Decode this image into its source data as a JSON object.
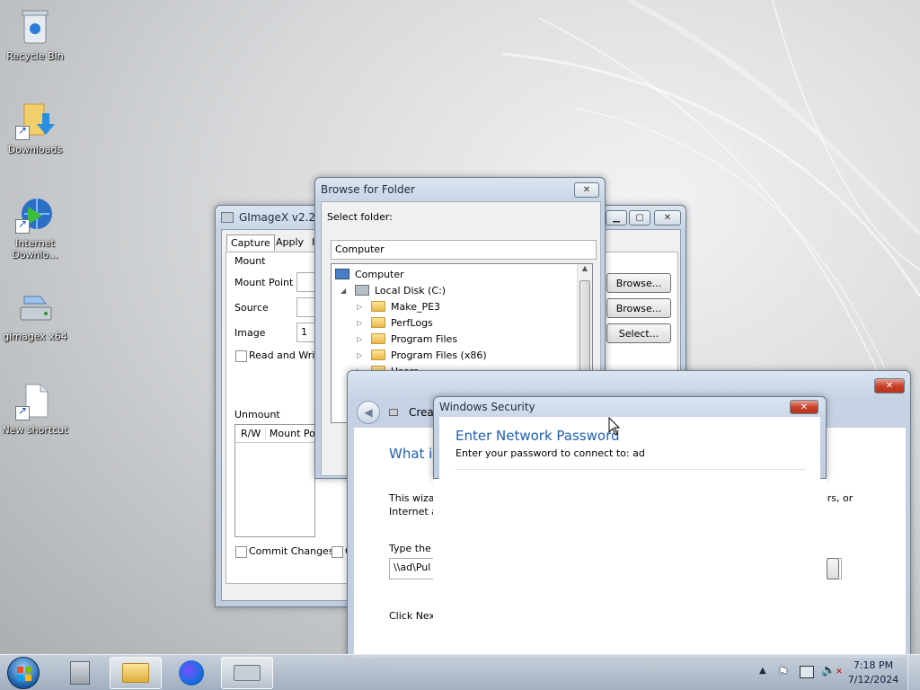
{
  "desktop": {
    "icons": [
      {
        "label": "Recycle Bin",
        "icon": "recycle-bin-icon"
      },
      {
        "label": "Downloads",
        "icon": "downloads-folder-icon"
      },
      {
        "label": "Internet Downlo...",
        "icon": "internet-download-manager-icon"
      },
      {
        "label": "gimagex x64",
        "icon": "gimagex-icon"
      },
      {
        "label": "New shortcut",
        "icon": "blank-document-icon"
      }
    ]
  },
  "gimagex": {
    "title": "GImageX v2.2.0",
    "tabs": [
      "Capture",
      "Apply",
      "I"
    ],
    "mount_group": "Mount",
    "mount_point_label": "Mount Point",
    "source_label": "Source",
    "image_label": "Image",
    "image_value": "1",
    "read_write_label": "Read and Write",
    "browse_label_1": "Browse...",
    "browse_label_2": "Browse...",
    "select_label": "Select...",
    "unmount_group": "Unmount",
    "columns": [
      "R/W",
      "Mount Poi"
    ],
    "commit_changes_label": "Commit Changes",
    "second_checkbox_label": "C"
  },
  "browse_folder": {
    "title": "Browse for Folder",
    "select_label": "Select folder:",
    "folder_value": "Computer",
    "tree": [
      {
        "label": "Computer",
        "level": 0,
        "kind": "computer"
      },
      {
        "label": "Local Disk (C:)",
        "level": 1,
        "kind": "drive"
      },
      {
        "label": "Make_PE3",
        "level": 2,
        "kind": "folder"
      },
      {
        "label": "PerfLogs",
        "level": 2,
        "kind": "folder"
      },
      {
        "label": "Program Files",
        "level": 2,
        "kind": "folder"
      },
      {
        "label": "Program Files (x86)",
        "level": 2,
        "kind": "folder"
      },
      {
        "label": "Users",
        "level": 2,
        "kind": "folder"
      }
    ]
  },
  "wizard": {
    "header_text": "Creat",
    "question": "What it",
    "body_line1": "This wizar",
    "body_line1_tail": "ers, or",
    "body_line2": "Internet a",
    "type_the": "Type the",
    "address_value": "\\\\ad\\Pul",
    "click_next": "Click Nex"
  },
  "security": {
    "title": "Windows Security",
    "heading": "Enter Network Password",
    "subtext": "Enter your password to connect to: ad"
  },
  "taskbar": {
    "items": [
      "start-orb-icon",
      "server-manager-icon",
      "file-explorer-icon",
      "firefox-icon",
      "gimagex-icon"
    ],
    "time": "7:18 PM",
    "date": "7/12/2024"
  },
  "colors": {
    "accent_blue": "#1e5fb5",
    "close_red": "#c7412a"
  }
}
